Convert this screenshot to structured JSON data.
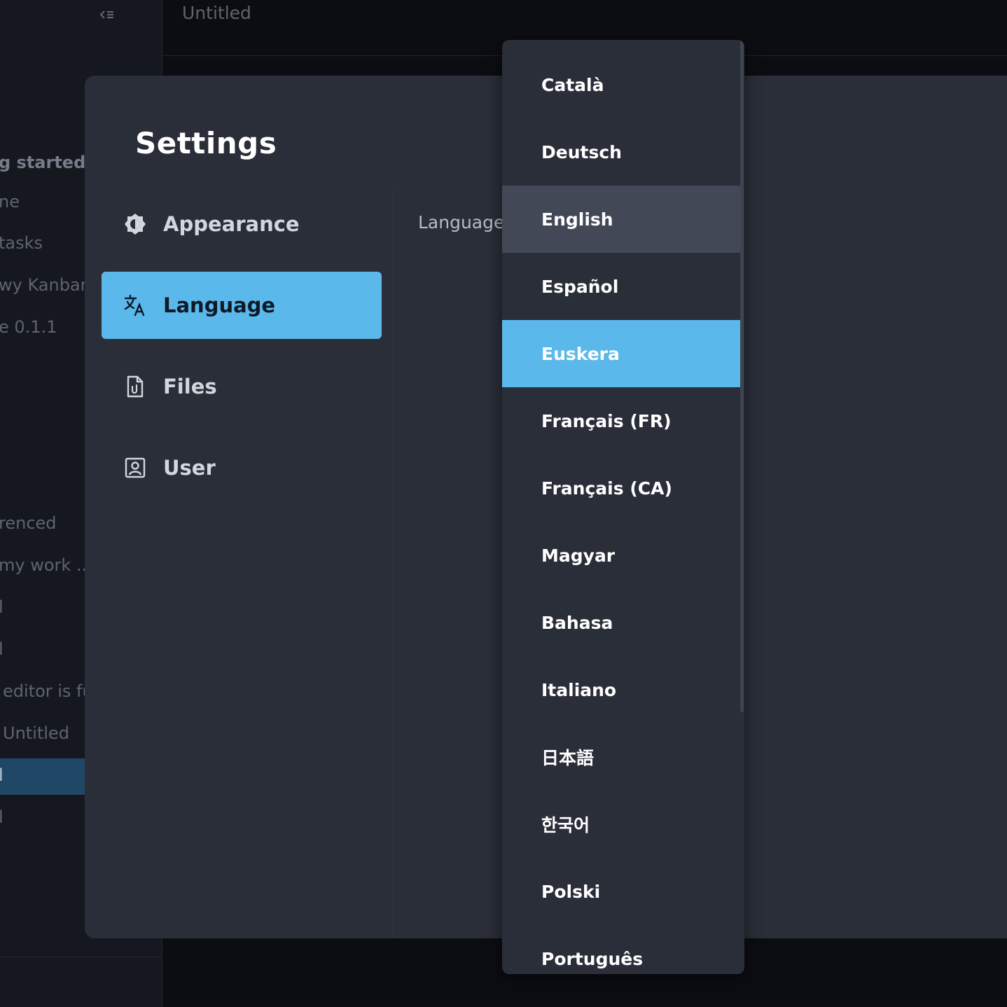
{
  "background": {
    "sidebar_items": [
      {
        "label": "g started",
        "bold": true
      },
      {
        "label": "ne",
        "bold": false
      },
      {
        "label": "tasks",
        "bold": false
      },
      {
        "label": "wy Kanban",
        "bold": false
      },
      {
        "label": "e 0.1.1",
        "bold": false
      },
      {
        "label": "renced",
        "bold": false
      },
      {
        "label": "my work ...",
        "bold": false
      },
      {
        "label": "l",
        "bold": false
      },
      {
        "label": "l",
        "bold": false
      },
      {
        "label": "editor is fu",
        "bold": false
      },
      {
        "label": "Untitled",
        "bold": false
      },
      {
        "label": "l",
        "bold": false
      },
      {
        "label": "l",
        "bold": false
      }
    ],
    "editor_title": "Untitled"
  },
  "settings": {
    "title": "Settings",
    "menu": [
      {
        "label": "Appearance",
        "icon": "appearance-icon"
      },
      {
        "label": "Language",
        "icon": "translate-icon"
      },
      {
        "label": "Files",
        "icon": "file-icon"
      },
      {
        "label": "User",
        "icon": "user-icon"
      }
    ],
    "active_menu": "Language",
    "language_field_label": "Language"
  },
  "language_dropdown": {
    "options": [
      "Català",
      "Deutsch",
      "English",
      "Español",
      "Euskera",
      "Français (FR)",
      "Français (CA)",
      "Magyar",
      "Bahasa",
      "Italiano",
      "日本語",
      "한국어",
      "Polski",
      "Português"
    ],
    "hovered": "English",
    "selected": "Euskera"
  },
  "colors": {
    "accent": "#5bb8eb",
    "modal_bg": "#2a2e39",
    "hover_bg": "#434856"
  }
}
